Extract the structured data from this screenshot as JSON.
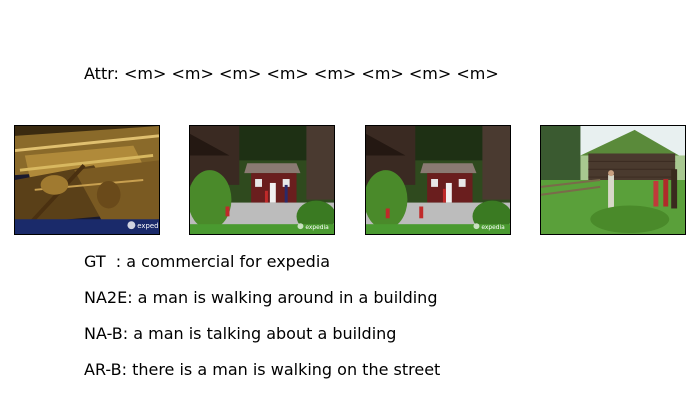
{
  "attr_line": "Attr: <m> <m> <m> <m> <m> <m> <m> <m>",
  "frames": [
    {
      "icon": "wooden-ship-frame",
      "watermark": "expedia"
    },
    {
      "icon": "red-house-village-frame",
      "watermark": "expedia"
    },
    {
      "icon": "red-house-village-frame",
      "watermark": "expedia"
    },
    {
      "icon": "grass-roof-cabin-frame",
      "watermark": ""
    }
  ],
  "captions": [
    "GT  : a commercial for expedia",
    "NA2E: a man is walking around in a building",
    "NA-B: a man is talking about a building",
    "AR-B: there is a man is walking on the street"
  ]
}
